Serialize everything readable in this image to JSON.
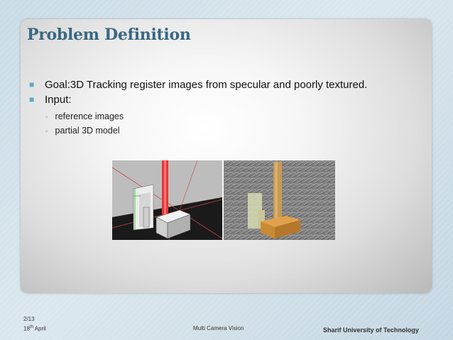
{
  "slide": {
    "title": "Problem Definition",
    "bullets": [
      "Goal:3D Tracking register images from specular and poorly textured.",
      "Input:"
    ],
    "sub_bullets": [
      "reference images",
      "partial 3D model"
    ],
    "images": [
      {
        "description_icon": "rendered-3d-model-image"
      },
      {
        "description_icon": "tracked-object-photo-image"
      }
    ]
  },
  "footer": {
    "page": "2/13",
    "date_day": "18",
    "date_suffix": "th",
    "date_month": " April",
    "center": "Multi Camera Vision",
    "right": "Sharif University of Technology"
  },
  "colors": {
    "title": "#3a6882",
    "bullet_mark": "#5ba6c6",
    "background": "#c9dbe6"
  }
}
